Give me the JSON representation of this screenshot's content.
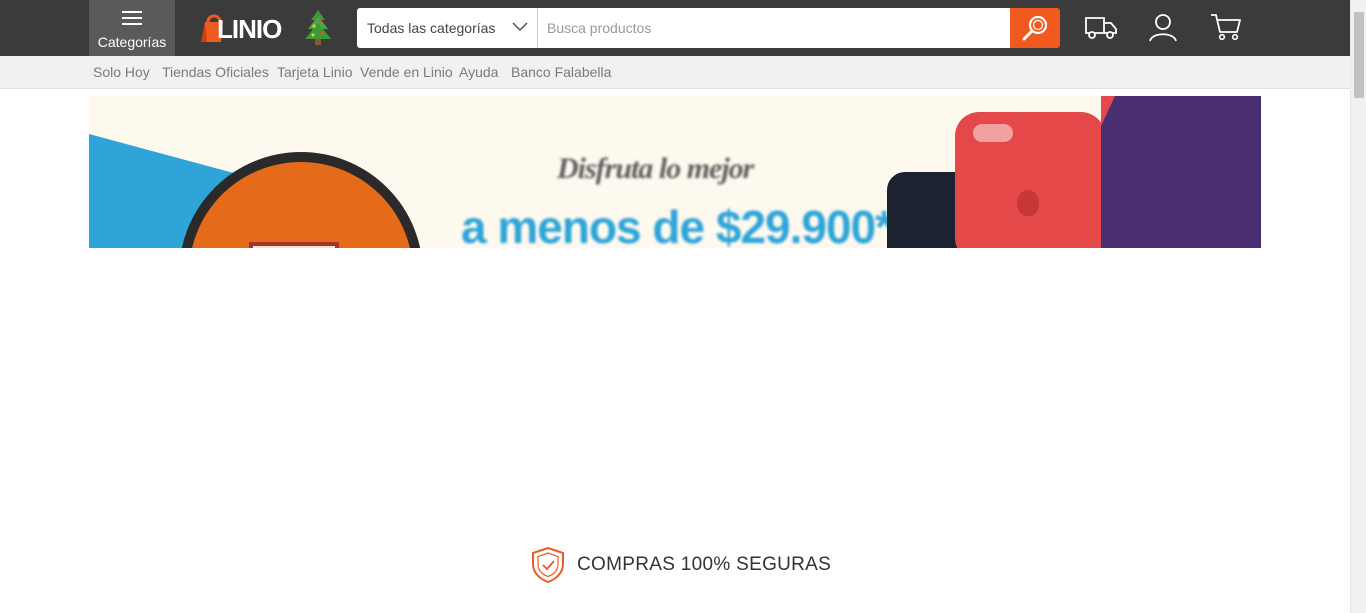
{
  "header": {
    "categories_label": "Categorías",
    "logo_text": "LINIO",
    "category_select": {
      "selected": "Todas las categorías"
    },
    "search": {
      "placeholder": "Busca productos",
      "value": ""
    }
  },
  "icons": {
    "menu": "hamburger-icon",
    "logo_bag": "shopping-bag-icon",
    "holiday": "christmas-tree-icon",
    "dropdown": "chevron-down-icon",
    "search": "magnifier-icon",
    "shipping": "delivery-truck-icon",
    "account": "user-icon",
    "cart": "shopping-cart-icon",
    "secure": "shield-check-icon"
  },
  "subnav": {
    "items": [
      "Solo Hoy",
      "Tiendas Oficiales",
      "Tarjeta Linio",
      "Vende en Linio",
      "Ayuda",
      "Banco Falabella"
    ]
  },
  "banner": {
    "headline": "Disfruta lo mejor",
    "price_line": "a menos de $29.900*"
  },
  "secure": {
    "label": "COMPRAS 100% SEGURAS"
  },
  "colors": {
    "header_bg": "#3b3b3b",
    "accent": "#f05a1e",
    "subnav_bg": "#f1f1f1",
    "banner_blue": "#2ea4d8",
    "banner_purple": "#4a2f72"
  }
}
